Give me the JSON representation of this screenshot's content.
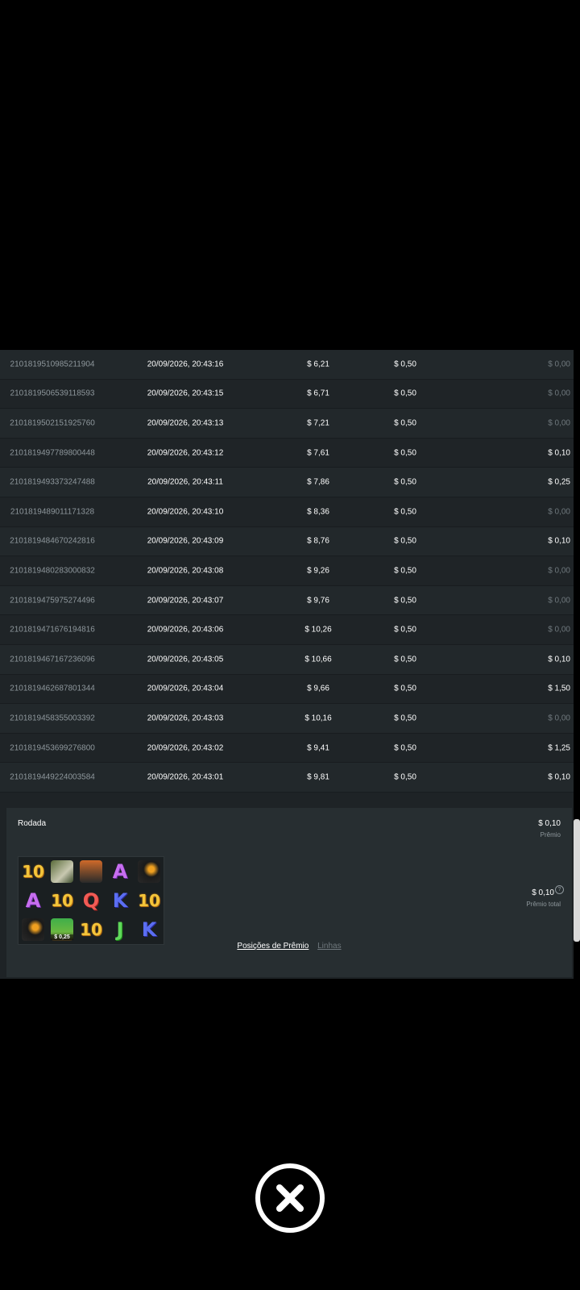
{
  "rows": [
    {
      "id": "2101819510985211904",
      "date": "20/09/2026, 20:43:16",
      "balance": "$ 6,21",
      "bet": "$ 0,50",
      "win": "$ 0,00",
      "zero": true
    },
    {
      "id": "2101819506539118593",
      "date": "20/09/2026, 20:43:15",
      "balance": "$ 6,71",
      "bet": "$ 0,50",
      "win": "$ 0,00",
      "zero": true
    },
    {
      "id": "2101819502151925760",
      "date": "20/09/2026, 20:43:13",
      "balance": "$ 7,21",
      "bet": "$ 0,50",
      "win": "$ 0,00",
      "zero": true
    },
    {
      "id": "2101819497789800448",
      "date": "20/09/2026, 20:43:12",
      "balance": "$ 7,61",
      "bet": "$ 0,50",
      "win": "$ 0,10",
      "zero": false
    },
    {
      "id": "2101819493373247488",
      "date": "20/09/2026, 20:43:11",
      "balance": "$ 7,86",
      "bet": "$ 0,50",
      "win": "$ 0,25",
      "zero": false
    },
    {
      "id": "2101819489011171328",
      "date": "20/09/2026, 20:43:10",
      "balance": "$ 8,36",
      "bet": "$ 0,50",
      "win": "$ 0,00",
      "zero": true
    },
    {
      "id": "2101819484670242816",
      "date": "20/09/2026, 20:43:09",
      "balance": "$ 8,76",
      "bet": "$ 0,50",
      "win": "$ 0,10",
      "zero": false
    },
    {
      "id": "2101819480283000832",
      "date": "20/09/2026, 20:43:08",
      "balance": "$ 9,26",
      "bet": "$ 0,50",
      "win": "$ 0,00",
      "zero": true
    },
    {
      "id": "2101819475975274496",
      "date": "20/09/2026, 20:43:07",
      "balance": "$ 9,76",
      "bet": "$ 0,50",
      "win": "$ 0,00",
      "zero": true
    },
    {
      "id": "2101819471676194816",
      "date": "20/09/2026, 20:43:06",
      "balance": "$ 10,26",
      "bet": "$ 0,50",
      "win": "$ 0,00",
      "zero": true
    },
    {
      "id": "2101819467167236096",
      "date": "20/09/2026, 20:43:05",
      "balance": "$ 10,66",
      "bet": "$ 0,50",
      "win": "$ 0,10",
      "zero": false
    },
    {
      "id": "2101819462687801344",
      "date": "20/09/2026, 20:43:04",
      "balance": "$ 9,66",
      "bet": "$ 0,50",
      "win": "$ 1,50",
      "zero": false
    },
    {
      "id": "2101819458355003392",
      "date": "20/09/2026, 20:43:03",
      "balance": "$ 10,16",
      "bet": "$ 0,50",
      "win": "$ 0,00",
      "zero": true
    },
    {
      "id": "2101819453699276800",
      "date": "20/09/2026, 20:43:02",
      "balance": "$ 9,41",
      "bet": "$ 0,50",
      "win": "$ 1,25",
      "zero": false
    },
    {
      "id": "2101819449224003584",
      "date": "20/09/2026, 20:43:01",
      "balance": "$ 9,81",
      "bet": "$ 0,50",
      "win": "$ 0,10",
      "zero": false
    }
  ],
  "detail": {
    "title": "Rodada",
    "prize_value": "$ 0,10",
    "prize_label": "Prêmio",
    "total_value": "$ 0,10",
    "total_label": "Prêmio total",
    "help_glyph": "?",
    "grid": [
      [
        "10",
        "crocodile",
        "truck",
        "A",
        "toucan"
      ],
      [
        "A",
        "10",
        "Q",
        "K",
        "10"
      ],
      [
        "toucan",
        "money-bag",
        "10",
        "J",
        "K"
      ]
    ],
    "money_value": "$ 0,25"
  },
  "tabs": {
    "active": "Posições de Prêmio",
    "other": "Linhas"
  },
  "colors": {
    "background": "#000000",
    "panel": "#1e2326",
    "muted_text": "#8e979c",
    "zero_text": "#6f787d"
  }
}
